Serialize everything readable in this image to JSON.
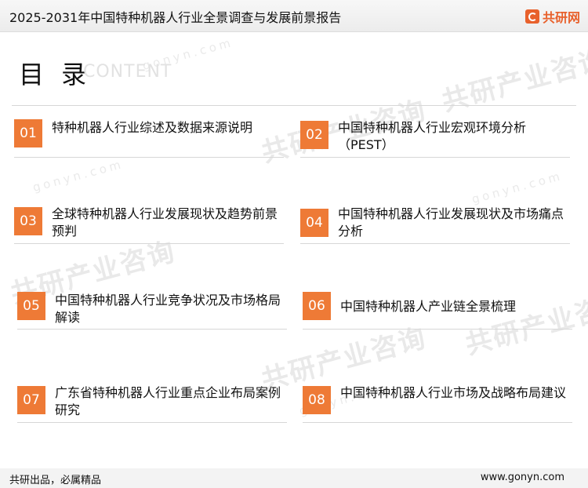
{
  "header": {
    "title": "2025-2031年中国特种机器人行业全景调查与发展前景报告",
    "brand": "共研网",
    "brand_color": "#e8612c"
  },
  "heading": {
    "title": "目 录",
    "subtitle": "CONTENT"
  },
  "accent_color": "#ee7a36",
  "toc": [
    {
      "num": "01",
      "text": "特种机器人行业综述及数据来源说明"
    },
    {
      "num": "02",
      "text": "中国特种机器人行业宏观环境分析（PEST）"
    },
    {
      "num": "03",
      "text": "全球特种机器人行业发展现状及趋势前景预判"
    },
    {
      "num": "04",
      "text": "中国特种机器人行业发展现状及市场痛点分析"
    },
    {
      "num": "05",
      "text": "中国特种机器人行业竞争状况及市场格局解读"
    },
    {
      "num": "06",
      "text": "中国特种机器人产业链全景梳理"
    },
    {
      "num": "07",
      "text": "广东省特种机器人行业重点企业布局案例研究"
    },
    {
      "num": "08",
      "text": "中国特种机器人行业市场及战略布局建议"
    }
  ],
  "watermark": {
    "brand": "共研产业咨询",
    "site": "gonyn.com"
  },
  "footer": {
    "slogan": "共研出品，必属精品",
    "site": "www.gonyn.com"
  }
}
